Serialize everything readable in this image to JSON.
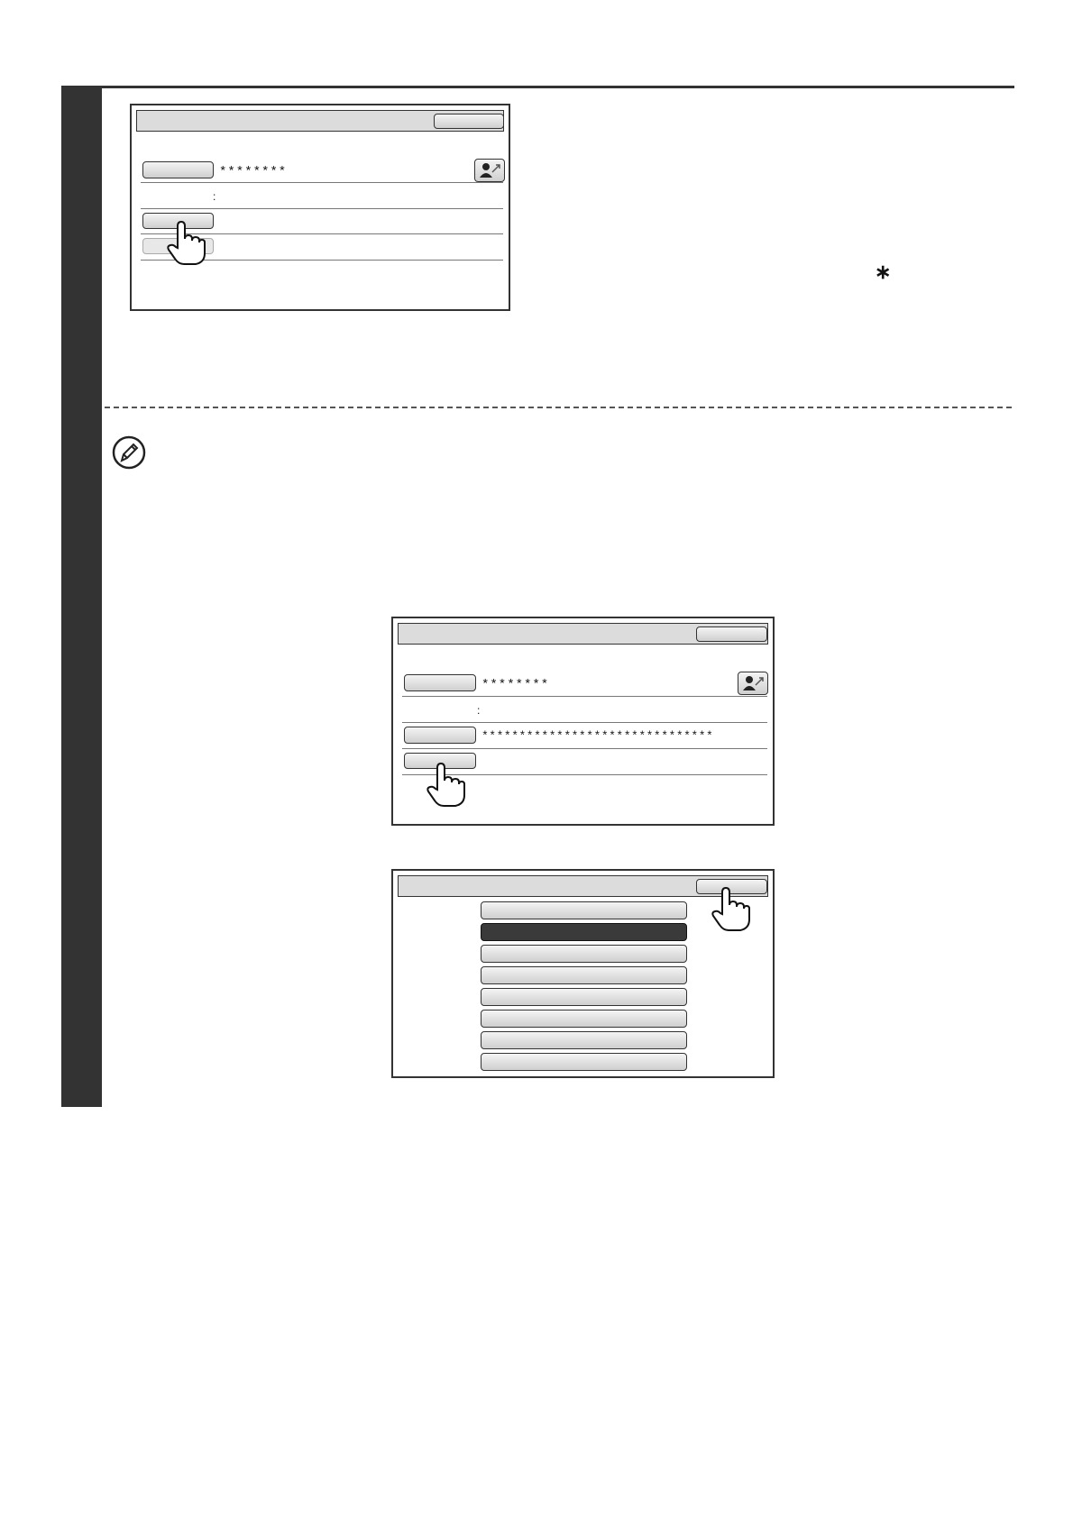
{
  "screen1": {
    "password_mask": "********",
    "separator": ":"
  },
  "screen2": {
    "password_mask": "********",
    "separator": ":",
    "key_mask": "*******************************"
  },
  "step_mark": "∗",
  "icons": {
    "note": "pencil-note-icon",
    "user": "user-arrow-icon",
    "pointer": "hand-pointer-icon"
  }
}
